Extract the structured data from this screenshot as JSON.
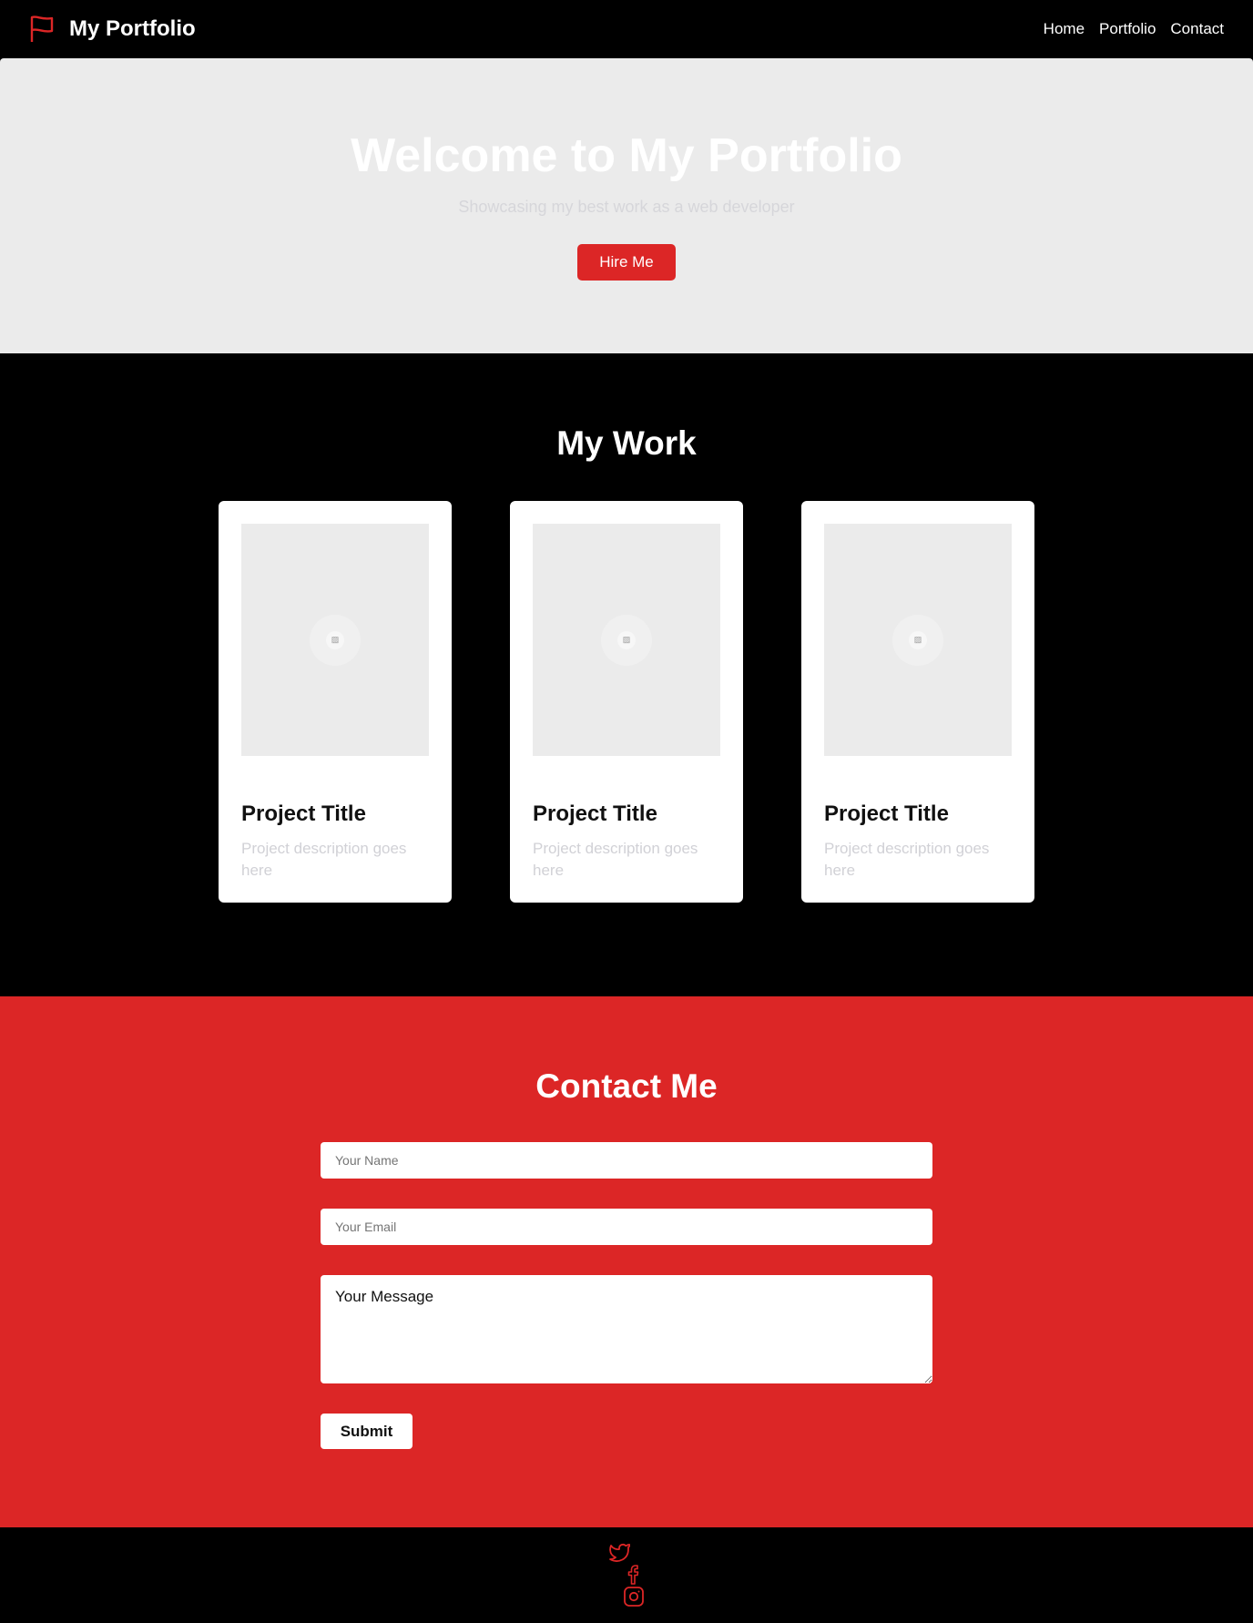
{
  "nav": {
    "brand": "My Portfolio",
    "links": [
      "Home",
      "Portfolio",
      "Contact"
    ]
  },
  "hero": {
    "title": "Welcome to My Portfolio",
    "subtitle": "Showcasing my best work as a web developer",
    "cta": "Hire Me"
  },
  "work": {
    "title": "My Work",
    "projects": [
      {
        "title": "Project Title",
        "description": "Project description goes here"
      },
      {
        "title": "Project Title",
        "description": "Project description goes here"
      },
      {
        "title": "Project Title",
        "description": "Project description goes here"
      }
    ]
  },
  "contact": {
    "title": "Contact Me",
    "name_placeholder": "Your Name",
    "email_placeholder": "Your Email",
    "message_value": "Your Message",
    "submit": "Submit"
  },
  "footer": {
    "icons": [
      "twitter-icon",
      "facebook-icon",
      "instagram-icon"
    ]
  },
  "colors": {
    "accent": "#dc2626",
    "hero_bg": "#ebebeb",
    "dark": "#000000"
  }
}
